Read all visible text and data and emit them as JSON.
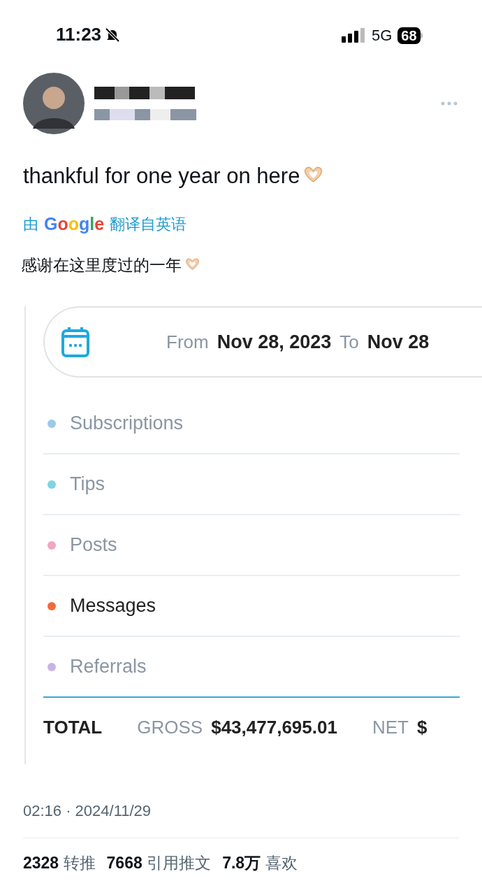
{
  "status_bar": {
    "time": "11:23",
    "network": "5G",
    "battery": "68",
    "silent": true
  },
  "tweet": {
    "text": "thankful for one year on here",
    "translation_label_prefix": "由",
    "translation_brand": "Google",
    "translation_label_suffix": "翻译自英语",
    "translation": "感谢在这里度过的一年"
  },
  "embedded": {
    "date_range": {
      "from_label": "From",
      "from_value": "Nov 28, 2023",
      "to_label": "To",
      "to_value": "Nov 28"
    },
    "categories": [
      {
        "label": "Subscriptions",
        "color": "#9cc9ea",
        "selected": false
      },
      {
        "label": "Tips",
        "color": "#7dd4e2",
        "selected": false
      },
      {
        "label": "Posts",
        "color": "#f0a6bf",
        "selected": false
      },
      {
        "label": "Messages",
        "color": "#f26a3c",
        "selected": true
      },
      {
        "label": "Referrals",
        "color": "#c8b4e4",
        "selected": false
      }
    ],
    "total": {
      "label": "TOTAL",
      "gross_label": "GROSS",
      "gross_value": "$43,477,695.01",
      "net_label": "NET",
      "net_value": "$"
    }
  },
  "timestamp": "02:16 · 2024/11/29",
  "stats": [
    {
      "count": "2328",
      "label": "转推"
    },
    {
      "count": "7668",
      "label": "引用推文"
    },
    {
      "count": "7.8万",
      "label": "喜欢"
    }
  ]
}
